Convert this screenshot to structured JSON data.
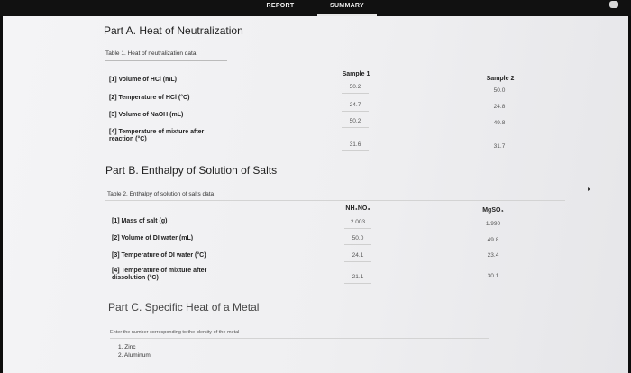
{
  "tabs": {
    "report": "REPORT",
    "summary": "SUMMARY"
  },
  "partA": {
    "title": "Part A. Heat of Neutralization",
    "caption": "Table 1. Heat of neutralization data",
    "columns": [
      "Sample 1",
      "Sample 2"
    ],
    "rows": [
      {
        "label": "[1] Volume of HCl (mL)",
        "values": [
          "50.2",
          "50.0"
        ]
      },
      {
        "label": "[2] Temperature of HCl (°C)",
        "values": [
          "24.7",
          "24.8"
        ]
      },
      {
        "label": "[3] Volume of NaOH (mL)",
        "values": [
          "50.2",
          "49.8"
        ]
      },
      {
        "label": "[4] Temperature of mixture after reaction (°C)",
        "label_line1": "[4] Temperature of mixture after",
        "label_line2": "reaction (°C)",
        "values": [
          "31.6",
          "31.7"
        ]
      }
    ]
  },
  "partB": {
    "title": "Part B. Enthalpy of Solution of Salts",
    "caption": "Table 2. Enthalpy of solution of salts data",
    "columns": [
      "NH₄NO₃",
      "MgSO₄"
    ],
    "rows": [
      {
        "label": "[1] Mass of salt (g)",
        "values": [
          "2.003",
          "1.990"
        ]
      },
      {
        "label": "[2] Volume of DI water (mL)",
        "values": [
          "50.0",
          "49.8"
        ]
      },
      {
        "label": "[3] Temperature of DI water (°C)",
        "values": [
          "24.1",
          "23.4"
        ]
      },
      {
        "label": "[4] Temperature of mixture after dissolution (°C)",
        "label_line1": "[4] Temperature of mixture after",
        "label_line2": "dissolution (°C)",
        "values": [
          "21.1",
          "30.1"
        ]
      }
    ]
  },
  "partC": {
    "title": "Part C. Specific Heat of a Metal",
    "instruction": "Enter the number corresponding to the identity of the metal",
    "options": [
      "1. Zinc",
      "2. Aluminum"
    ]
  }
}
